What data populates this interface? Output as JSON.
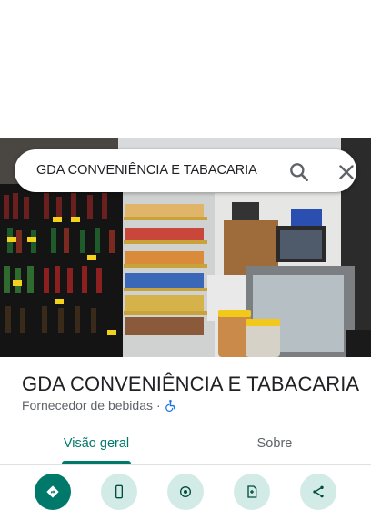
{
  "search": {
    "query": "GDA CONVENIÊNCIA E TABACARIA"
  },
  "place": {
    "name": "GDA CONVENIÊNCIA E TABACARIA",
    "category": "Fornecedor de bebidas",
    "separator": "·"
  },
  "tabs": [
    {
      "label": "Visão geral",
      "active": true
    },
    {
      "label": "Sobre",
      "active": false
    }
  ],
  "actions": [
    {
      "icon": "directions-icon"
    },
    {
      "icon": "phone-icon"
    },
    {
      "icon": "nearby-icon"
    },
    {
      "icon": "save-icon"
    },
    {
      "icon": "share-icon"
    }
  ],
  "colors": {
    "accent": "#00796b",
    "action_bg": "#d3ebe7",
    "accessibility": "#1a73e8"
  }
}
